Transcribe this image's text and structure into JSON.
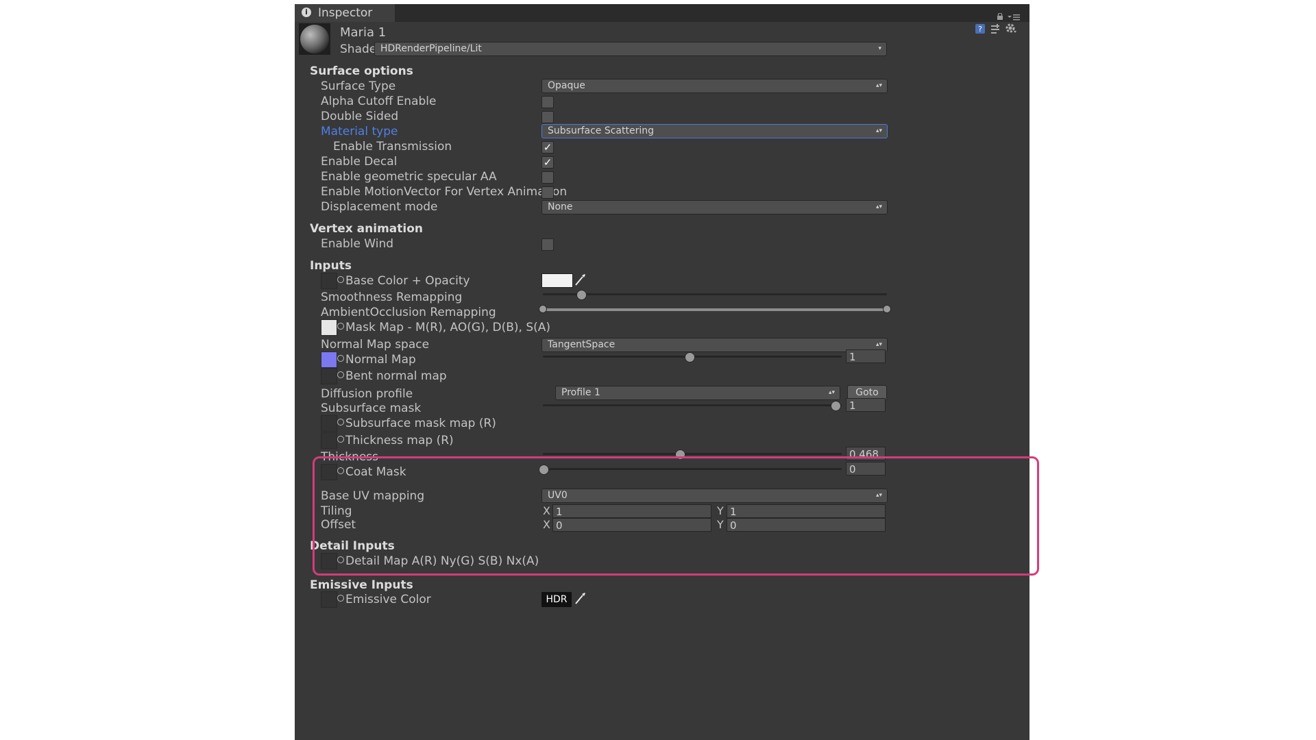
{
  "inspector": {
    "tab_label": "Inspector",
    "material_name": "Maria 1",
    "shader_label": "Shader",
    "shader_value": "HDRenderPipeline/Lit"
  },
  "surface": {
    "header": "Surface options",
    "surface_type_label": "Surface Type",
    "surface_type_value": "Opaque",
    "alpha_cutoff_label": "Alpha Cutoff Enable",
    "double_sided_label": "Double Sided",
    "material_type_label": "Material type",
    "material_type_value": "Subsurface Scattering",
    "enable_transmission_label": "Enable Transmission",
    "enable_decal_label": "Enable Decal",
    "geometric_aa_label": "Enable geometric specular AA",
    "motion_vector_label": "Enable MotionVector For Vertex Animation",
    "displacement_label": "Displacement mode",
    "displacement_value": "None",
    "checkboxes": {
      "alpha_cutoff": false,
      "double_sided": false,
      "enable_transmission": true,
      "enable_decal": true,
      "geometric_aa": false,
      "motion_vector": false
    }
  },
  "vertex": {
    "header": "Vertex animation",
    "enable_wind_label": "Enable Wind",
    "enable_wind": false
  },
  "inputs": {
    "header": "Inputs",
    "base_color_label": "Base Color + Opacity",
    "smoothness_label": "Smoothness Remapping",
    "ao_label": "AmbientOcclusion Remapping",
    "mask_map_label": "Mask Map - M(R), AO(G), D(B), S(A)",
    "normal_space_label": "Normal Map space",
    "normal_space_value": "TangentSpace",
    "normal_map_label": "Normal Map",
    "normal_map_value": "1",
    "normal_map_slider": 0.5,
    "bent_normal_label": "Bent normal map",
    "diffusion_label": "Diffusion profile",
    "diffusion_value": "Profile 1",
    "goto_label": "Goto",
    "subsurface_mask_label": "Subsurface mask",
    "subsurface_mask_value": "1",
    "subsurface_mask_slider": 1.0,
    "subsurface_map_label": "Subsurface mask map (R)",
    "thickness_map_label": "Thickness map (R)",
    "thickness_label": "Thickness",
    "thickness_value": "0.468",
    "thickness_slider": 0.468,
    "coat_mask_label": "Coat Mask",
    "coat_mask_value": "0",
    "coat_mask_slider": 0.0,
    "base_uv_label": "Base UV mapping",
    "base_uv_value": "UV0",
    "tiling_label": "Tiling",
    "offset_label": "Offset",
    "x_label": "X",
    "y_label": "Y",
    "tiling_x": "1",
    "tiling_y": "1",
    "offset_x": "0",
    "offset_y": "0"
  },
  "detail": {
    "header": "Detail Inputs",
    "detail_map_label": "Detail Map A(R) Ny(G) S(B) Nx(A)"
  },
  "emissive": {
    "header": "Emissive Inputs",
    "emissive_color_label": "Emissive Color",
    "hdr_label": "HDR"
  },
  "colors": {
    "highlight": "#d63c79",
    "material_type_label": "#4f7fe6",
    "panel_bg": "#383838"
  }
}
